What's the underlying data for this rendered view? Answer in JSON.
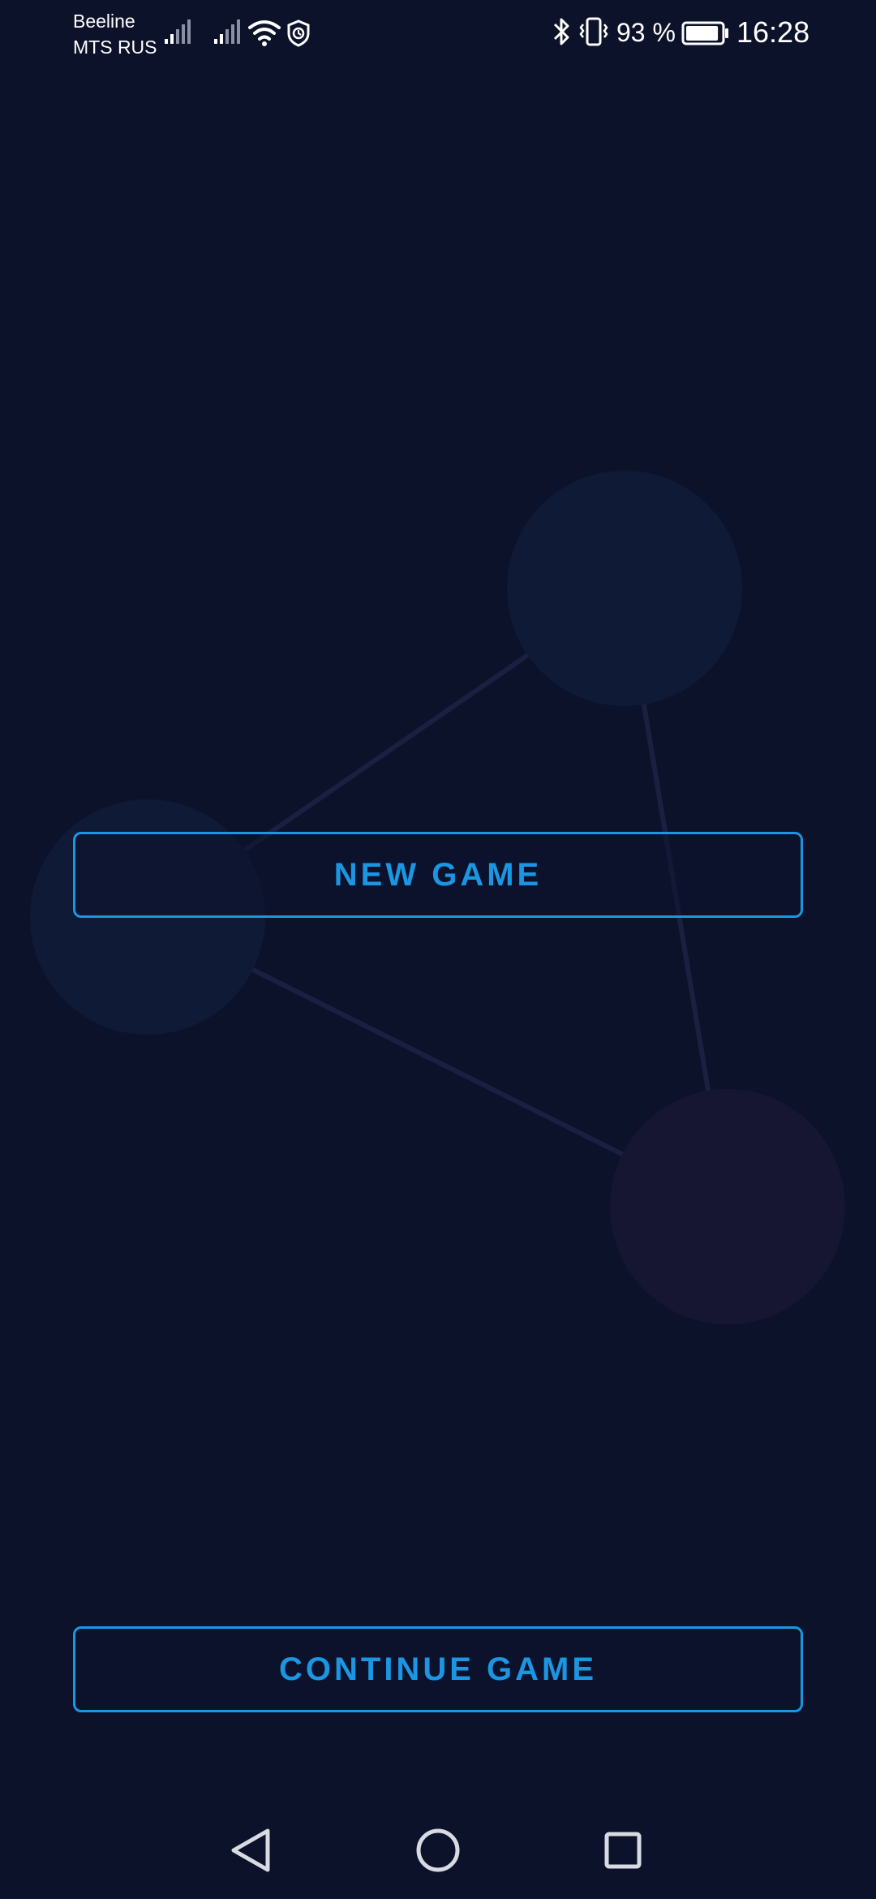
{
  "status_bar": {
    "carrier_1": "Beeline",
    "carrier_2": "MTS RUS",
    "battery_text": "93 %",
    "battery_level": 0.93,
    "time": "16:28",
    "icons": [
      "signal-icon",
      "signal-icon",
      "wifi-icon",
      "shield-icon",
      "bluetooth-icon",
      "vibrate-icon",
      "battery-icon"
    ]
  },
  "menu": {
    "new_game_label": "NEW GAME",
    "continue_game_label": "CONTINUE GAME"
  },
  "nav_bar": {
    "icons": [
      "back-icon",
      "home-icon",
      "recents-icon"
    ]
  },
  "colors": {
    "background": "#0d122b",
    "accent": "#1b96e3",
    "node_blue": "#0f1a36",
    "node_purple": "#161532",
    "edge": "#1a2040"
  }
}
